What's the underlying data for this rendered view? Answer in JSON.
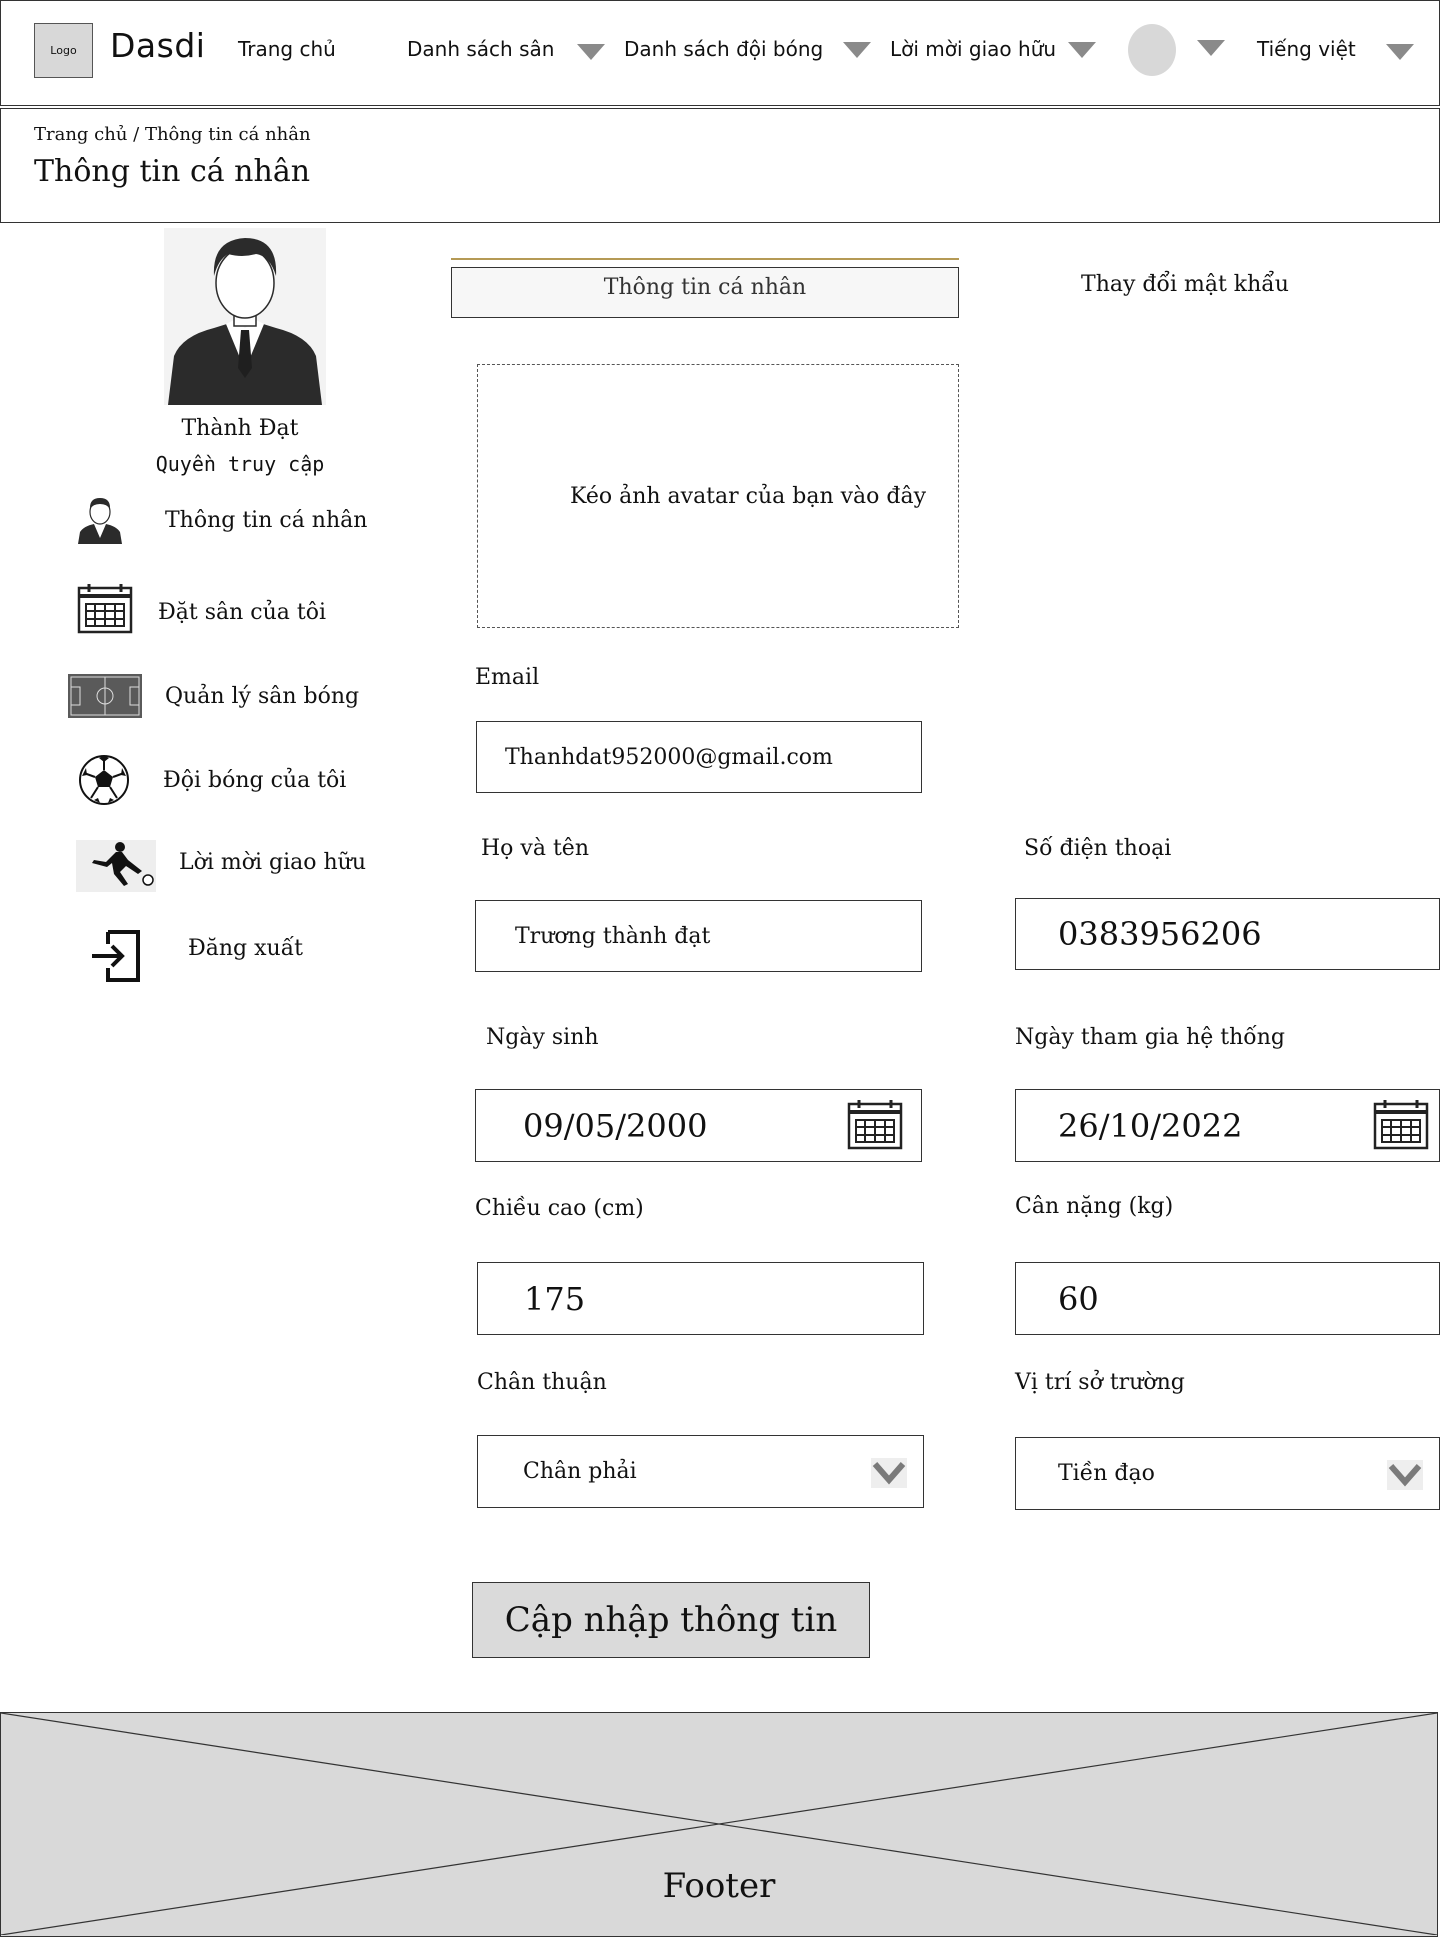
{
  "header": {
    "logo_label": "Logo",
    "brand": "Dasdi",
    "nav": {
      "home": "Trang chủ",
      "fields": "Danh sách sân",
      "teams": "Danh sách đội bóng",
      "invites": "Lời mời giao hữu",
      "language": "Tiếng việt"
    }
  },
  "banner": {
    "breadcrumb": "Trang chủ / Thông tin cá nhân",
    "title": "Thông tin cá nhân"
  },
  "profile": {
    "name": "Thành Đạt",
    "role": "Quyền truy cập"
  },
  "sidebar": {
    "items": [
      {
        "label": "Thông tin cá nhân",
        "icon": "person-icon"
      },
      {
        "label": "Đặt sân của tôi",
        "icon": "calendar-icon"
      },
      {
        "label": "Quản lý sân bóng",
        "icon": "soccer-field-icon"
      },
      {
        "label": "Đội bóng của tôi",
        "icon": "soccer-ball-icon"
      },
      {
        "label": "Lời mời giao hữu",
        "icon": "player-kick-icon"
      },
      {
        "label": "Đăng xuất",
        "icon": "logout-icon"
      }
    ]
  },
  "tabs": {
    "active": "Thông tin cá nhân",
    "other": "Thay đổi mật khẩu"
  },
  "dropzone": {
    "text": "Kéo ảnh avatar của bạn vào đây"
  },
  "form": {
    "email": {
      "label": "Email",
      "value": "Thanhdat952000@gmail.com"
    },
    "fullname": {
      "label": "Họ và tên",
      "value": "Trương thành đạt"
    },
    "phone": {
      "label": "Số điện thoại",
      "value": "0383956206"
    },
    "birthday": {
      "label": "Ngày sinh",
      "value": "09/05/2000"
    },
    "joined": {
      "label": "Ngày tham gia hệ thống",
      "value": "26/10/2022"
    },
    "height": {
      "label": "Chiều cao (cm)",
      "value": "175"
    },
    "weight": {
      "label": "Cân nặng (kg)",
      "value": "60"
    },
    "foot": {
      "label": "Chân thuận",
      "value": "Chân phải"
    },
    "position": {
      "label": "Vị trí sở trường",
      "value": "Tiền đạo"
    }
  },
  "submit_label": "Cập nhập thông tin",
  "footer": {
    "label": "Footer"
  },
  "colors": {
    "tab_accent": "#b59a55",
    "placeholder_gray": "#d9d9d9",
    "border": "#333333"
  }
}
